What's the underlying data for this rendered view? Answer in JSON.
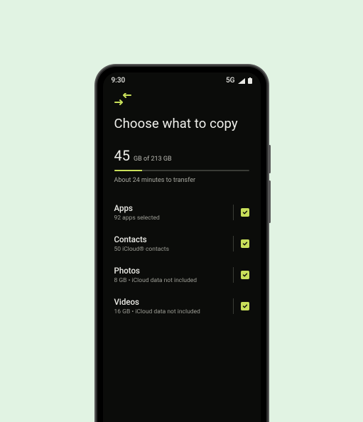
{
  "status": {
    "time": "9:30",
    "network": "5G"
  },
  "icon": "transfer-arrows",
  "title": "Choose what to copy",
  "usage": {
    "amount": "45",
    "unit_total": "GB of 213 GB",
    "progress_percent": 21
  },
  "eta": "About 24 minutes to transfer",
  "accent": "#c8df5a",
  "items": [
    {
      "title": "Apps",
      "subtitle": "92 apps selected",
      "checked": true
    },
    {
      "title": "Contacts",
      "subtitle": "50 iCloud® contacts",
      "checked": true
    },
    {
      "title": "Photos",
      "subtitle": "8 GB • iCloud data not included",
      "checked": true
    },
    {
      "title": "Videos",
      "subtitle": "16 GB • iCloud data not included",
      "checked": true
    }
  ]
}
